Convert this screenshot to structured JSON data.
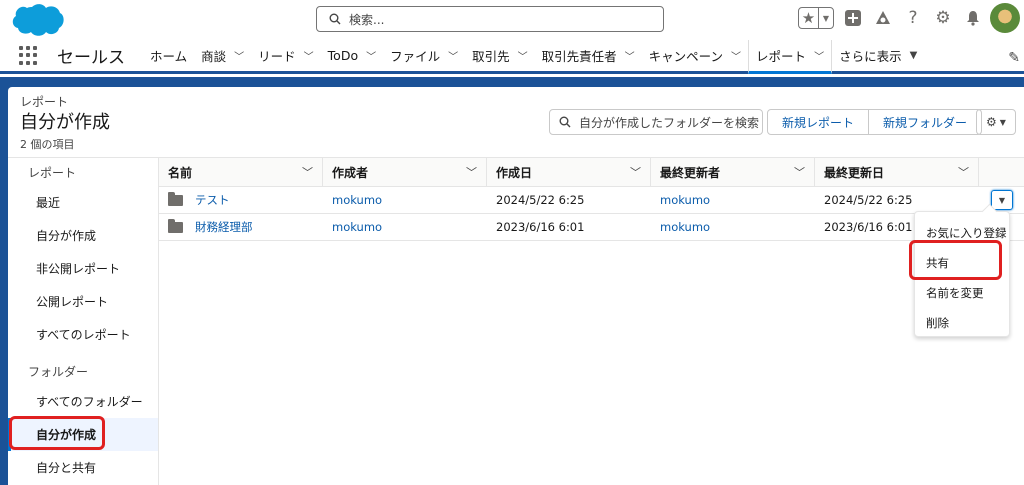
{
  "header": {
    "search_placeholder": "検索..."
  },
  "nav": {
    "app_name": "セールス",
    "items": [
      {
        "label": "ホーム",
        "chevron": false
      },
      {
        "label": "商談",
        "chevron": true
      },
      {
        "label": "リード",
        "chevron": true
      },
      {
        "label": "ToDo",
        "chevron": true
      },
      {
        "label": "ファイル",
        "chevron": true
      },
      {
        "label": "取引先",
        "chevron": true
      },
      {
        "label": "取引先責任者",
        "chevron": true
      },
      {
        "label": "キャンペーン",
        "chevron": true
      },
      {
        "label": "レポート",
        "chevron": true,
        "active": true
      },
      {
        "label": "さらに表示",
        "chevron": true
      }
    ]
  },
  "page": {
    "eyebrow": "レポート",
    "title": "自分が作成",
    "count": "2 個の項目",
    "folder_search_placeholder": "自分が作成したフォルダーを検索",
    "new_report_label": "新規レポート",
    "new_folder_label": "新規フォルダー"
  },
  "sidebar": {
    "reports_section": "レポート",
    "report_items": [
      "最近",
      "自分が作成",
      "非公開レポート",
      "公開レポート",
      "すべてのレポート"
    ],
    "folders_section": "フォルダー",
    "folder_items": [
      "すべてのフォルダー",
      "自分が作成",
      "自分と共有"
    ],
    "selected_folder_index": 1
  },
  "table": {
    "columns": [
      "名前",
      "作成者",
      "作成日",
      "最終更新者",
      "最終更新日"
    ],
    "rows": [
      {
        "name": "テスト",
        "created_by": "mokumo",
        "created": "2024/5/22 6:25",
        "modified_by": "mokumo",
        "modified": "2024/5/22 6:25"
      },
      {
        "name": "財務経理部",
        "created_by": "mokumo",
        "created": "2023/6/16 6:01",
        "modified_by": "mokumo",
        "modified": "2023/6/16 6:01"
      }
    ]
  },
  "row_menu": {
    "items": [
      "お気に入り登録",
      "共有",
      "名前を変更",
      "削除"
    ]
  },
  "colors": {
    "brand_blue": "#1b5297",
    "link_blue": "#0b5cab",
    "highlight_red": "#e02020"
  }
}
